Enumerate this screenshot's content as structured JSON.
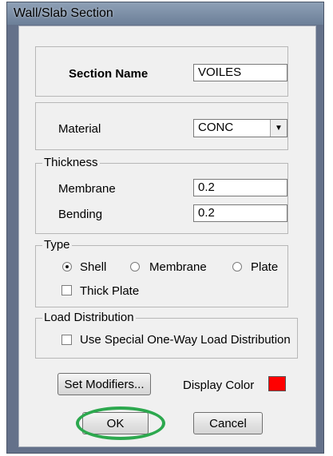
{
  "window": {
    "title": "Wall/Slab Section"
  },
  "section": {
    "label": "Section Name",
    "value": "VOILES"
  },
  "material": {
    "label": "Material",
    "value": "CONC"
  },
  "thickness": {
    "legend": "Thickness",
    "membrane_label": "Membrane",
    "membrane_value": "0.2",
    "bending_label": "Bending",
    "bending_value": "0.2"
  },
  "type": {
    "legend": "Type",
    "options": [
      "Shell",
      "Membrane",
      "Plate"
    ],
    "selected": "Shell",
    "thick_plate_label": "Thick Plate",
    "thick_plate_checked": false
  },
  "load_distribution": {
    "legend": "Load Distribution",
    "checkbox_label": "Use Special One-Way Load Distribution",
    "checked": false
  },
  "modifiers_button": "Set Modifiers...",
  "display_color": {
    "label": "Display Color",
    "color": "#ff0000"
  },
  "buttons": {
    "ok": "OK",
    "cancel": "Cancel"
  },
  "annotation": {
    "highlight_color": "#2ca84e"
  }
}
